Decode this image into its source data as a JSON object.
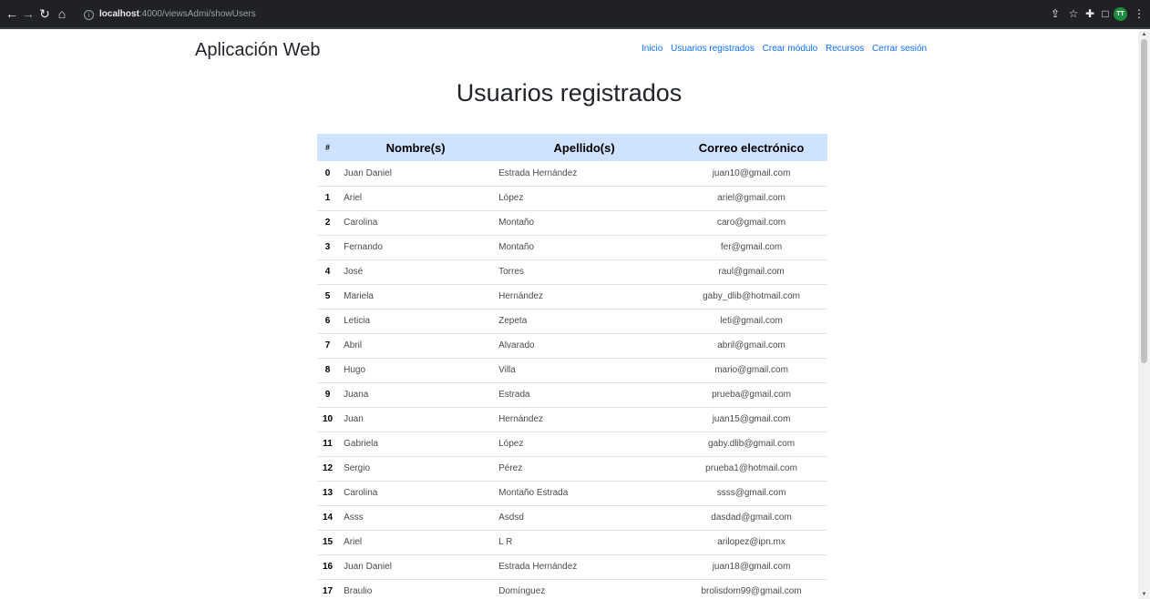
{
  "browser": {
    "url_host": "localhost",
    "url_rest": ":4000/viewsAdmi/showUsers",
    "avatar_initials": "TT"
  },
  "header": {
    "brand": "Aplicación Web",
    "nav": [
      "Inicio",
      "Usuarios registrados",
      "Crear módulo",
      "Recursos",
      "Cerrar sesión"
    ]
  },
  "main": {
    "title": "Usuarios registrados",
    "columns": [
      "#",
      "Nombre(s)",
      "Apellido(s)",
      "Correo electrónico"
    ],
    "rows": [
      [
        "0",
        "Juan Daniel",
        "Estrada Hernández",
        "juan10@gmail.com"
      ],
      [
        "1",
        "Ariel",
        "López",
        "ariel@gmail.com"
      ],
      [
        "2",
        "Carolina",
        "Montaño",
        "caro@gmail.com"
      ],
      [
        "3",
        "Fernando",
        "Montaño",
        "fer@gmail.com"
      ],
      [
        "4",
        "José",
        "Torres",
        "raul@gmail.com"
      ],
      [
        "5",
        "Mariela",
        "Hernández",
        "gaby_dlib@hotmail.com"
      ],
      [
        "6",
        "Leticia",
        "Zepeta",
        "leti@gmail.com"
      ],
      [
        "7",
        "Abril",
        "Alvarado",
        "abril@gmail.com"
      ],
      [
        "8",
        "Hugo",
        "Villa",
        "mario@gmail.com"
      ],
      [
        "9",
        "Juana",
        "Estrada",
        "prueba@gmail.com"
      ],
      [
        "10",
        "Juan",
        "Hernández",
        "juan15@gmail.com"
      ],
      [
        "11",
        "Gabriela",
        "López",
        "gaby.dlib@gmail.com"
      ],
      [
        "12",
        "Sergio",
        "Pérez",
        "prueba1@hotmail.com"
      ],
      [
        "13",
        "Carolina",
        "Montaño Estrada",
        "ssss@gmail.com"
      ],
      [
        "14",
        "Asss",
        "Asdsd",
        "dasdad@gmail.com"
      ],
      [
        "15",
        "Ariel",
        "L R",
        "arilopez@ipn.mx"
      ],
      [
        "16",
        "Juan Daniel",
        "Estrada Hernández",
        "juan18@gmail.com"
      ],
      [
        "17",
        "Braulio",
        "Domínguez",
        "brolisdom99@gmail.com"
      ]
    ]
  }
}
